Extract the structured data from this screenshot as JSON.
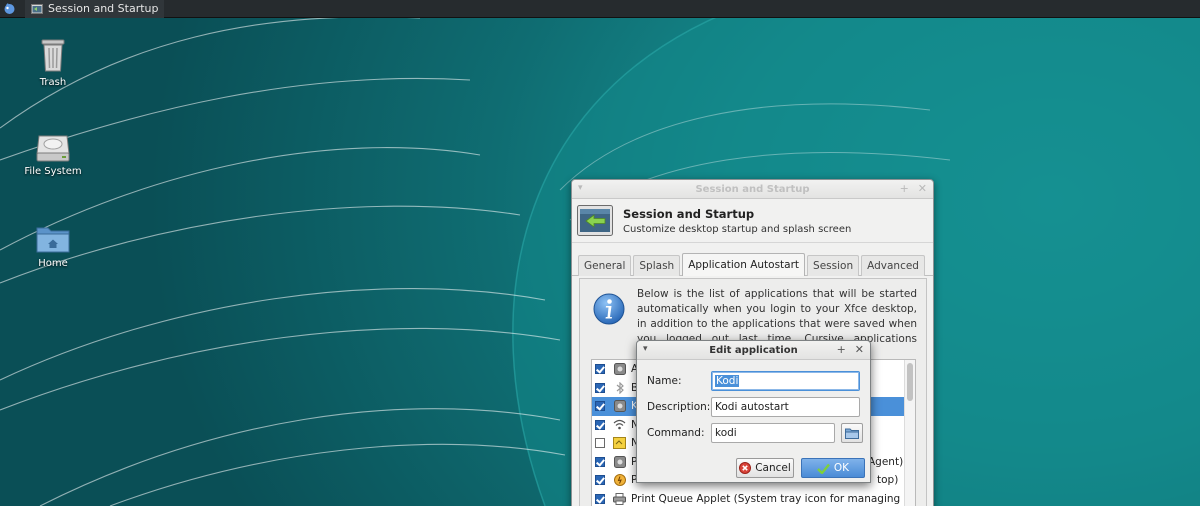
{
  "panel": {
    "task_title": "Session and Startup"
  },
  "desktop_icons": [
    {
      "label": "Trash",
      "icon": "trash-icon"
    },
    {
      "label": "File System",
      "icon": "drive-icon"
    },
    {
      "label": "Home",
      "icon": "home-folder-icon"
    }
  ],
  "main_window": {
    "title": "Session and Startup",
    "header_title": "Session and Startup",
    "header_subtitle": "Customize desktop startup and splash screen",
    "tabs": [
      "General",
      "Splash",
      "Application Autostart",
      "Session",
      "Advanced"
    ],
    "active_tab": "Application Autostart",
    "info_text": "Below is the list of applications that will be started automatically when you login to your Xfce desktop, in addition to the applications that were saved when you logged out last time. Cursive applications belong to another desktop",
    "autostart_items": [
      {
        "label": "A",
        "checked": true,
        "selected": false,
        "icon": "app-generic-icon"
      },
      {
        "label": "B",
        "checked": true,
        "selected": false,
        "icon": "bluetooth-icon"
      },
      {
        "label": "K",
        "checked": true,
        "selected": true,
        "icon": "app-generic-icon"
      },
      {
        "label": "N",
        "checked": true,
        "selected": false,
        "icon": "wifi-icon"
      },
      {
        "label": "N",
        "checked": false,
        "selected": false,
        "icon": "note-icon"
      },
      {
        "label": "P",
        "tail": "Agent)",
        "checked": true,
        "selected": false,
        "icon": "app-generic-icon"
      },
      {
        "label": "P",
        "tail": "top)",
        "checked": true,
        "selected": false,
        "icon": "power-icon"
      },
      {
        "label": "Print Queue Applet (System tray icon for managing print jobs)",
        "checked": true,
        "selected": false,
        "icon": "printer-icon"
      }
    ]
  },
  "edit_dialog": {
    "title": "Edit application",
    "name_label": "Name:",
    "name_value": "Kodi",
    "description_label": "Description:",
    "description_value": "Kodi autostart",
    "command_label": "Command:",
    "command_value": "kodi",
    "cancel_label": "Cancel",
    "ok_label": "OK"
  }
}
